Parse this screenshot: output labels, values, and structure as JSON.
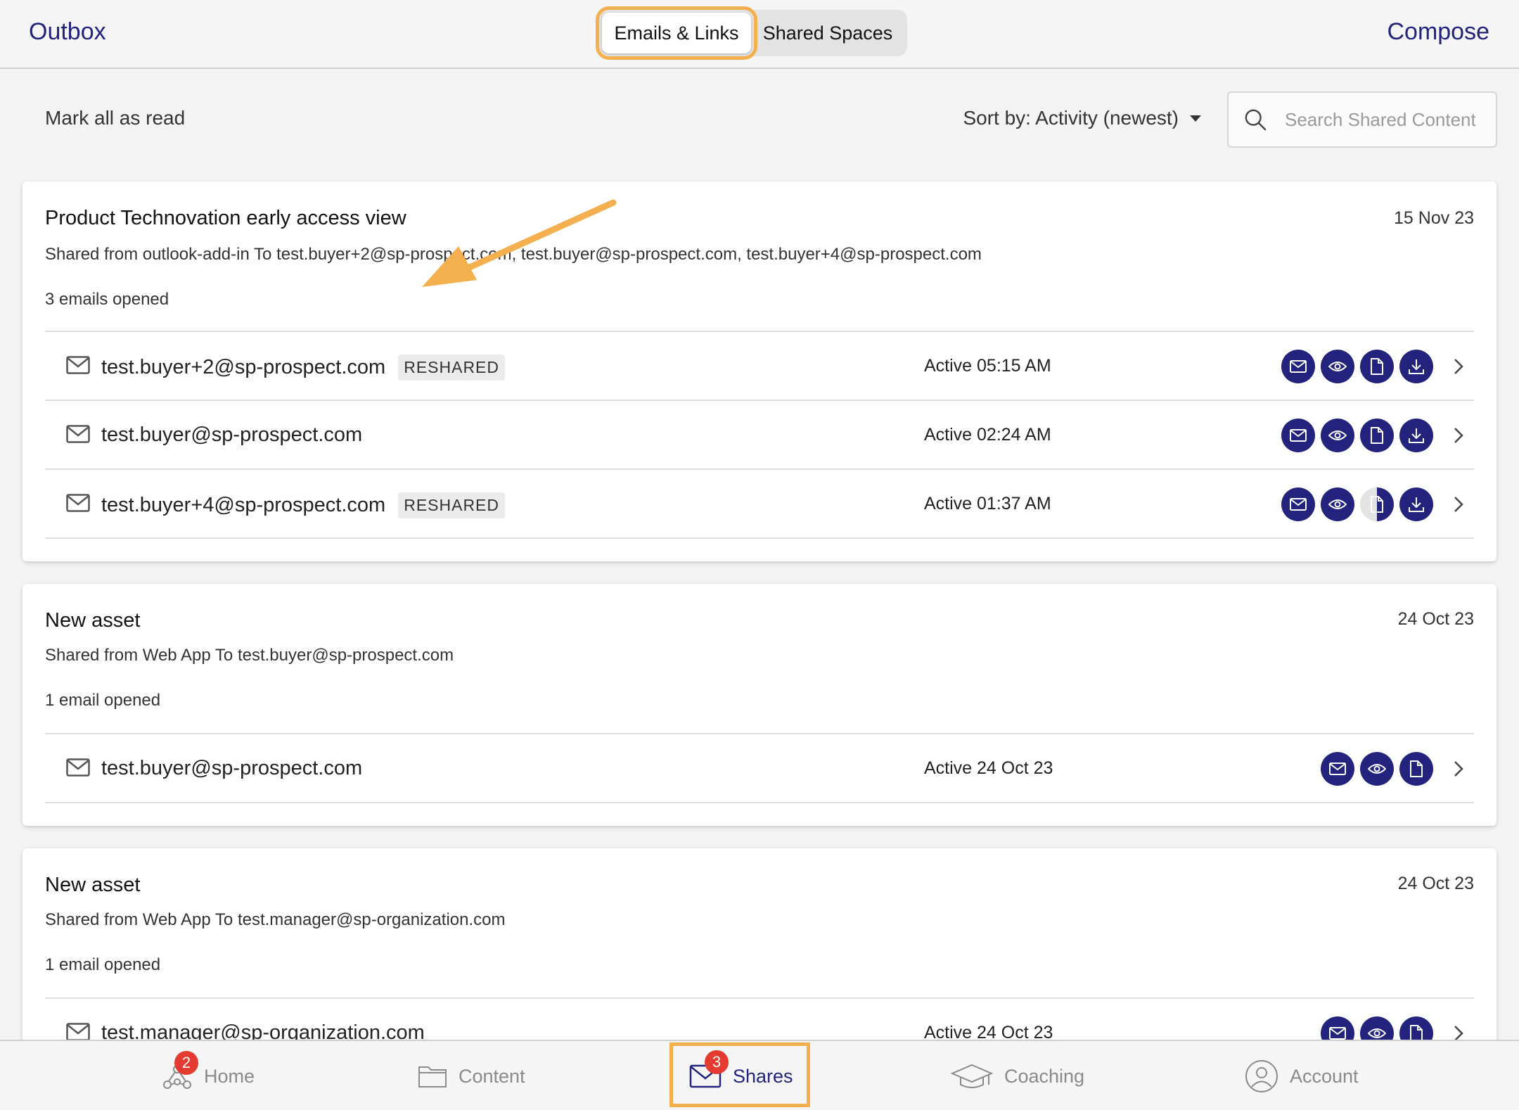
{
  "header": {
    "outbox_label": "Outbox",
    "compose_label": "Compose",
    "tabs": [
      {
        "label": "Emails & Links",
        "active": true
      },
      {
        "label": "Shared Spaces",
        "active": false
      }
    ]
  },
  "toolbar": {
    "mark_all_label": "Mark all as read",
    "sort_label": "Sort by: Activity (newest)",
    "search_placeholder": "Search Shared Content"
  },
  "shares": [
    {
      "title": "Product Technovation early access view",
      "date": "15 Nov 23",
      "shared_line": "Shared from outlook-add-in To test.buyer+2@sp-prospect.com, test.buyer@sp-prospect.com, test.buyer+4@sp-prospect.com",
      "opened": "3 emails opened",
      "recipients": [
        {
          "email": "test.buyer+2@sp-prospect.com",
          "badge": "RESHARED",
          "active": "Active 05:15 AM"
        },
        {
          "email": "test.buyer@sp-prospect.com",
          "badge": "",
          "active": "Active 02:24 AM"
        },
        {
          "email": "test.buyer+4@sp-prospect.com",
          "badge": "RESHARED",
          "active": "Active 01:37 AM"
        }
      ]
    },
    {
      "title": "New asset",
      "date": "24 Oct 23",
      "shared_line": "Shared from Web App To test.buyer@sp-prospect.com",
      "opened": "1 email opened",
      "recipients": [
        {
          "email": "test.buyer@sp-prospect.com",
          "badge": "",
          "active": "Active 24 Oct 23"
        }
      ]
    },
    {
      "title": "New asset",
      "date": "24 Oct 23",
      "shared_line": "Shared from Web App To test.manager@sp-organization.com",
      "opened": "1 email opened",
      "recipients": [
        {
          "email": "test.manager@sp-organization.com",
          "badge": "",
          "active": "Active 24 Oct 23"
        }
      ]
    }
  ],
  "tabbar": {
    "items": [
      {
        "label": "Home",
        "icon": "network-icon",
        "badge": "2"
      },
      {
        "label": "Content",
        "icon": "folder-icon",
        "badge": ""
      },
      {
        "label": "Shares",
        "icon": "envelope-icon",
        "badge": "3",
        "selected": true
      },
      {
        "label": "Coaching",
        "icon": "graduation-cap-icon",
        "badge": ""
      },
      {
        "label": "Account",
        "icon": "person-icon",
        "badge": ""
      }
    ]
  },
  "colors": {
    "accent": "#23237e",
    "highlight": "#f4b04f",
    "notification": "#e53a2f"
  }
}
